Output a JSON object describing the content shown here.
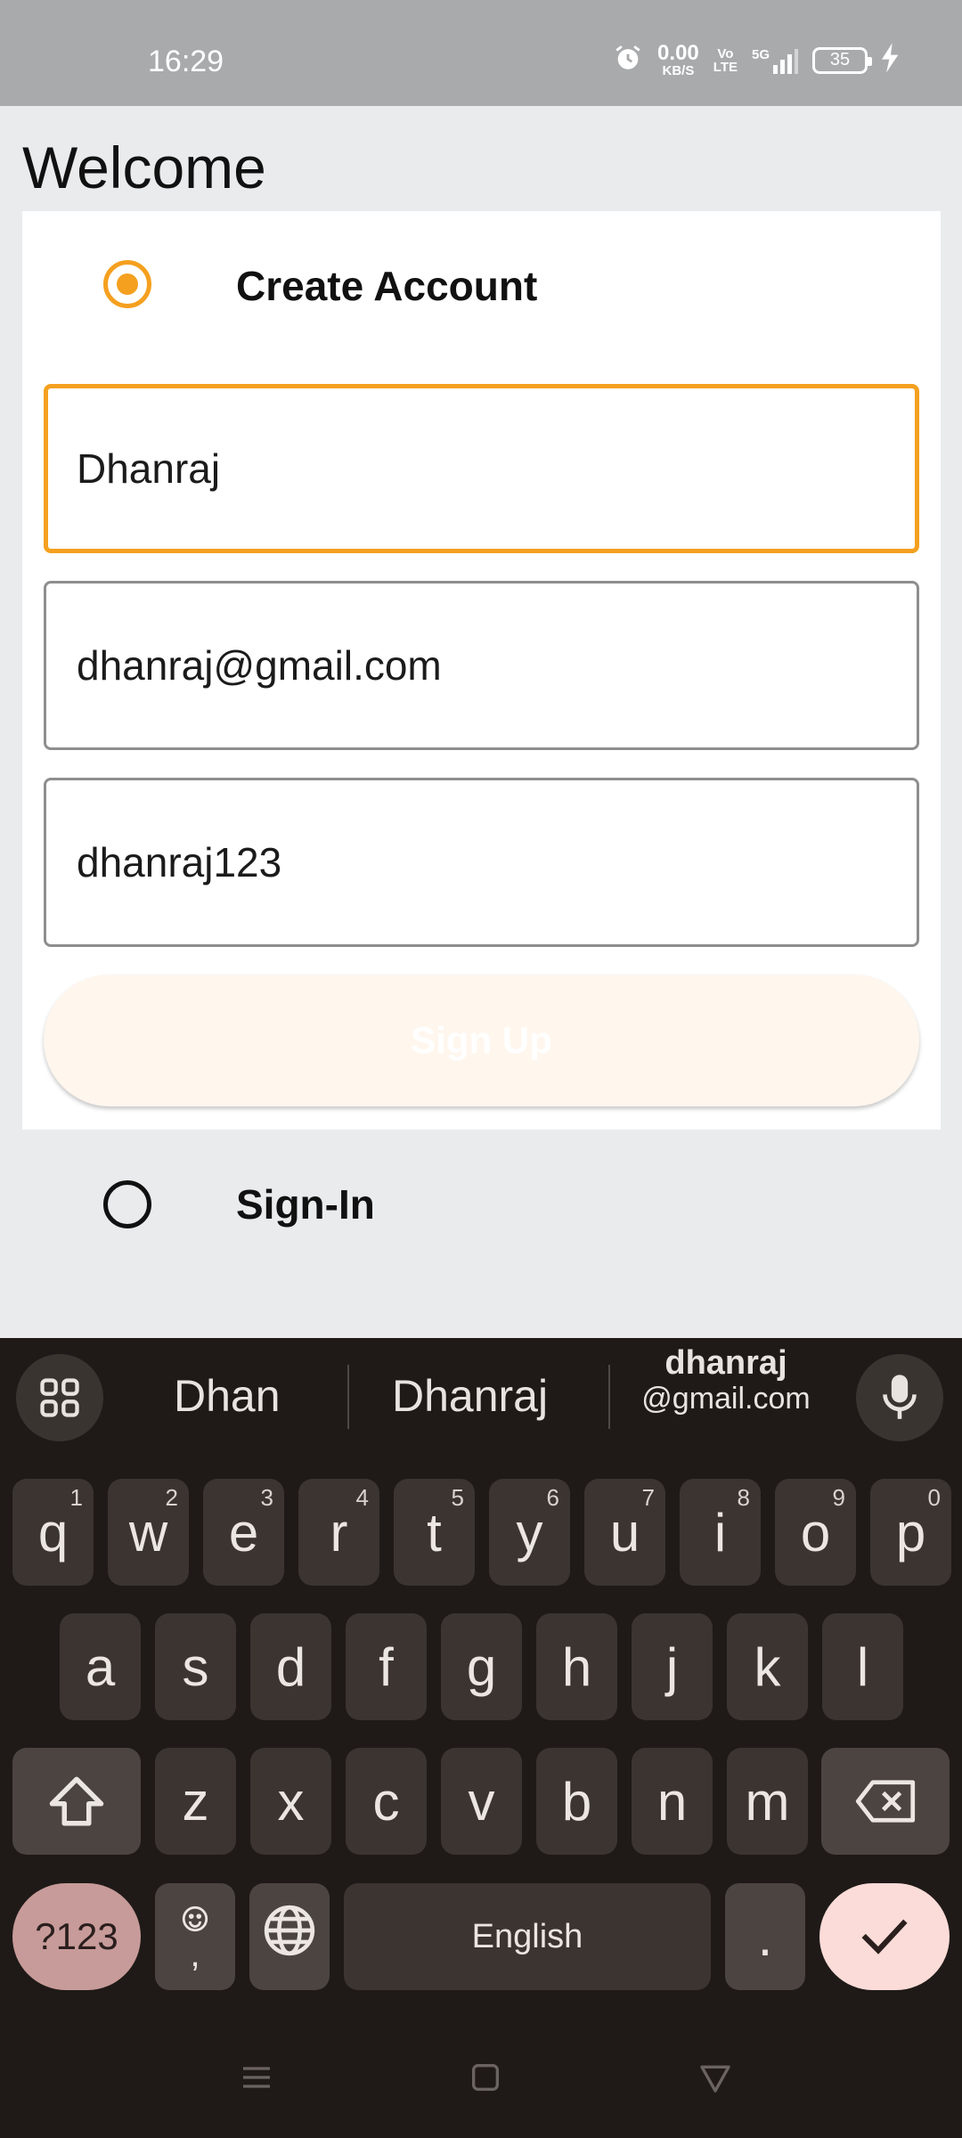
{
  "status_bar": {
    "time": "16:29",
    "net_speed_value": "0.00",
    "net_speed_unit": "KB/S",
    "volte_top": "Vo",
    "volte_bottom": "LTE",
    "network": "5G",
    "battery": "35",
    "icons": [
      "alarm-icon",
      "signal-icon",
      "battery-icon",
      "charging-icon"
    ]
  },
  "page": {
    "title": "Welcome"
  },
  "create_account": {
    "label": "Create Account",
    "selected": true,
    "fields": {
      "name_value": "Dhanraj",
      "email_value": "dhanraj@gmail.com",
      "password_value": "dhanraj123"
    },
    "signup_label": "Sign Up"
  },
  "sign_in": {
    "label": "Sign-In",
    "selected": false
  },
  "keyboard": {
    "suggestions": [
      "Dhan",
      "Dhanraj"
    ],
    "suggestion_email_top": "dhanraj",
    "suggestion_email_bottom": "@gmail.com",
    "row1": [
      {
        "k": "q",
        "h": "1"
      },
      {
        "k": "w",
        "h": "2"
      },
      {
        "k": "e",
        "h": "3"
      },
      {
        "k": "r",
        "h": "4"
      },
      {
        "k": "t",
        "h": "5"
      },
      {
        "k": "y",
        "h": "6"
      },
      {
        "k": "u",
        "h": "7"
      },
      {
        "k": "i",
        "h": "8"
      },
      {
        "k": "o",
        "h": "9"
      },
      {
        "k": "p",
        "h": "0"
      }
    ],
    "row2": [
      "a",
      "s",
      "d",
      "f",
      "g",
      "h",
      "j",
      "k",
      "l"
    ],
    "row3": [
      "z",
      "x",
      "c",
      "v",
      "b",
      "n",
      "m"
    ],
    "sym_label": "?123",
    "comma_label": ",",
    "space_label": "English",
    "period_label": ".",
    "colors": {
      "background": "#1f1a18",
      "key": "#3b3431",
      "sym_key": "#c79b99",
      "enter_key": "#fcdcd8"
    }
  },
  "colors": {
    "accent": "#f5a01f",
    "status_bar": "#a9aaac",
    "page_bg": "#eaebed",
    "signup_bg": "#fff6ee"
  }
}
